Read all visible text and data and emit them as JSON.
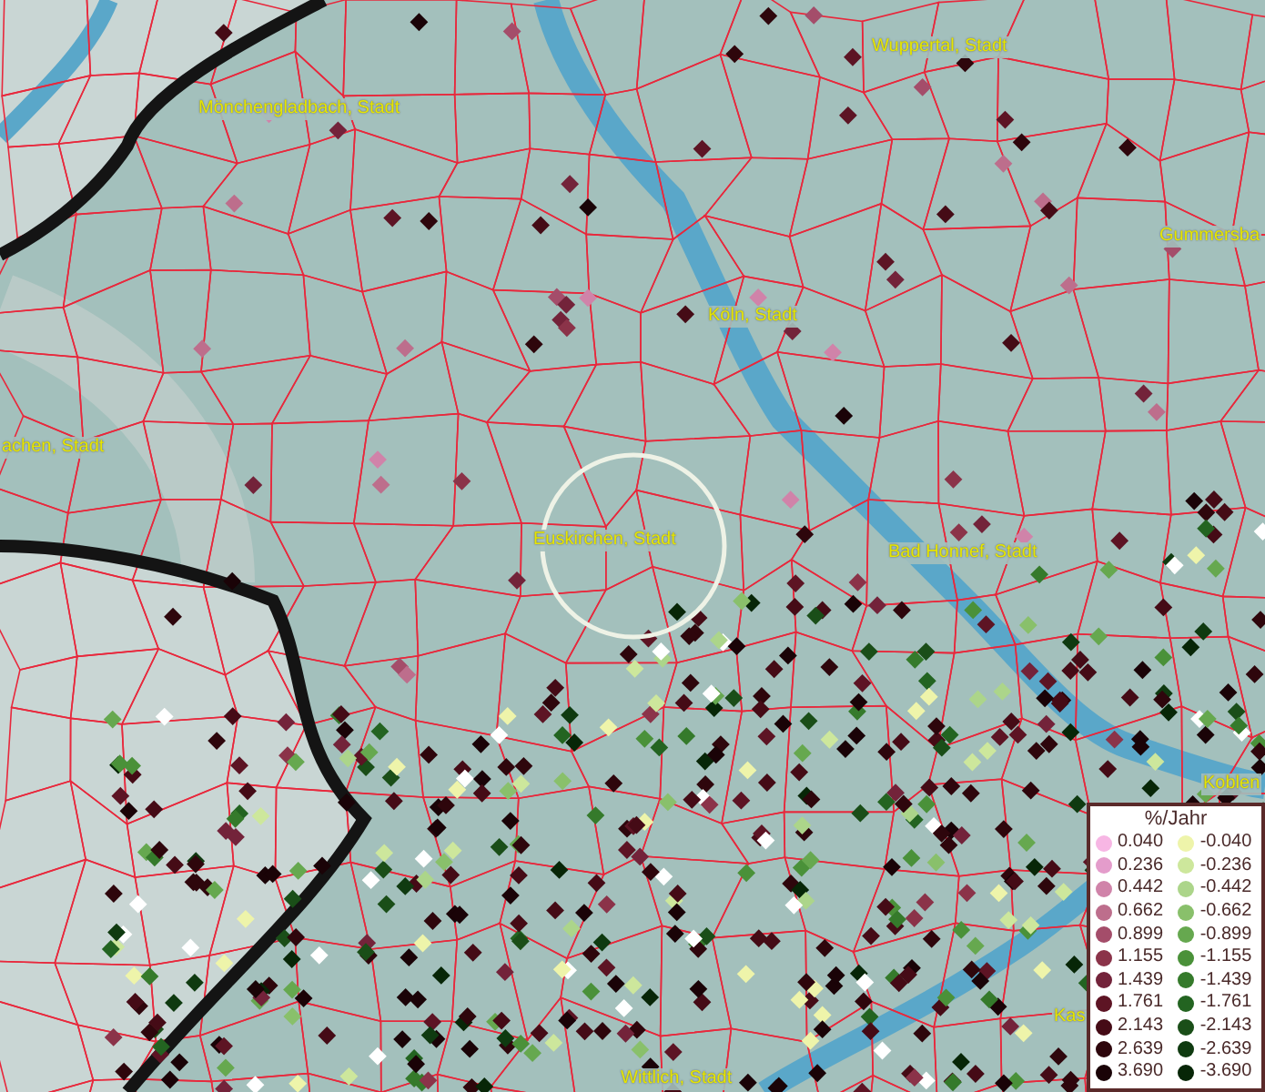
{
  "map": {
    "places": [
      {
        "name": "Mönchengladbach, Stadt"
      },
      {
        "name": "Wuppertal, Stadt"
      },
      {
        "name": "Gummersba"
      },
      {
        "name": "Köln, Stadt"
      },
      {
        "name": "achen, Stadt"
      },
      {
        "name": "Euskirchen, Stadt"
      },
      {
        "name": "Bad Honnef, Stadt"
      },
      {
        "name": "Koblen"
      },
      {
        "name": "Kas"
      },
      {
        "name": "Wittlich, Stadt"
      }
    ]
  },
  "legend": {
    "title": "%/Jahr",
    "positive": [
      {
        "value": "0.040",
        "color": "#f7b6e4"
      },
      {
        "value": "0.236",
        "color": "#e49ccb"
      },
      {
        "value": "0.442",
        "color": "#d083a9"
      },
      {
        "value": "0.662",
        "color": "#bd6e8c"
      },
      {
        "value": "0.899",
        "color": "#a44d6a"
      },
      {
        "value": "1.155",
        "color": "#8b3349"
      },
      {
        "value": "1.439",
        "color": "#73233a"
      },
      {
        "value": "1.761",
        "color": "#5d1424"
      },
      {
        "value": "2.143",
        "color": "#450b16"
      },
      {
        "value": "2.639",
        "color": "#2e060c"
      },
      {
        "value": "3.690",
        "color": "#1a0307"
      }
    ],
    "negative": [
      {
        "value": "-0.040",
        "color": "#eef4aa"
      },
      {
        "value": "-0.236",
        "color": "#cde79c"
      },
      {
        "value": "-0.442",
        "color": "#acd58a"
      },
      {
        "value": "-0.662",
        "color": "#89c06b"
      },
      {
        "value": "-0.899",
        "color": "#66a84f"
      },
      {
        "value": "-1.155",
        "color": "#4a9139"
      },
      {
        "value": "-1.439",
        "color": "#357a2b"
      },
      {
        "value": "-1.761",
        "color": "#236421"
      },
      {
        "value": "-2.143",
        "color": "#1a4e18"
      },
      {
        "value": "-2.639",
        "color": "#0f3a10"
      },
      {
        "value": "-3.690",
        "color": "#072607"
      }
    ]
  }
}
